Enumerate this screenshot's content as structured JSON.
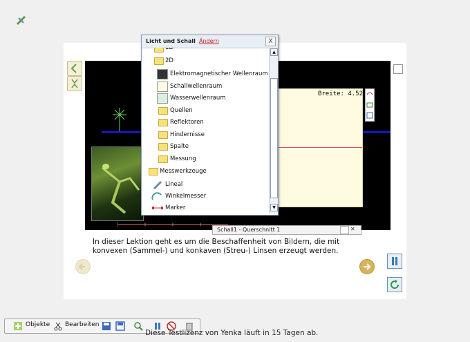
{
  "popup": {
    "title": "Licht und Schall",
    "change_label": "Ändern",
    "close_label": "X",
    "top_partial_label": "1D",
    "folder_2d_label": "2D",
    "items_2d": [
      {
        "label": "Elektromagnetischer Wellenraum",
        "kind": "swatch",
        "color": "#333333"
      },
      {
        "label": "Schallwellenraum",
        "kind": "swatch",
        "color": "#fffbe0"
      },
      {
        "label": "Wasserwellenraum",
        "kind": "swatch",
        "color": "#ddf0e0"
      },
      {
        "label": "Quellen",
        "kind": "folder"
      },
      {
        "label": "Reflektoren",
        "kind": "folder"
      },
      {
        "label": "Hindernisse",
        "kind": "folder"
      },
      {
        "label": "Spalte",
        "kind": "folder"
      },
      {
        "label": "Messung",
        "kind": "folder"
      }
    ],
    "tools_folder_label": "Messwerkzeuge",
    "tools": [
      {
        "label": "Lineal",
        "icon": "ruler-icon"
      },
      {
        "label": "Winkelmesser",
        "icon": "protractor-icon"
      },
      {
        "label": "Marker",
        "icon": "marker-icon"
      }
    ]
  },
  "simulation": {
    "width_readout": "Breite: 4.52 m",
    "bottom_tab_label": "Schall1 - Querschnitt 1"
  },
  "lesson": {
    "text": "In dieser Lektion geht es um die Beschaffenheit von Bildern, die mit konvexen (Sammel-) und konkaven (Streu-) Linsen erzeugt werden."
  },
  "toolbar": {
    "objects_label": "Objekte",
    "edit_label": "Bearbeiten"
  },
  "license_text": "Diese Testlizenz von Yenka läuft in 15 Tagen ab.",
  "colors": {
    "sim_background": "#000000",
    "wave_area": "#fffbe0",
    "nav_button": "#d8b35a",
    "accent_blue": "#1a1aff"
  }
}
